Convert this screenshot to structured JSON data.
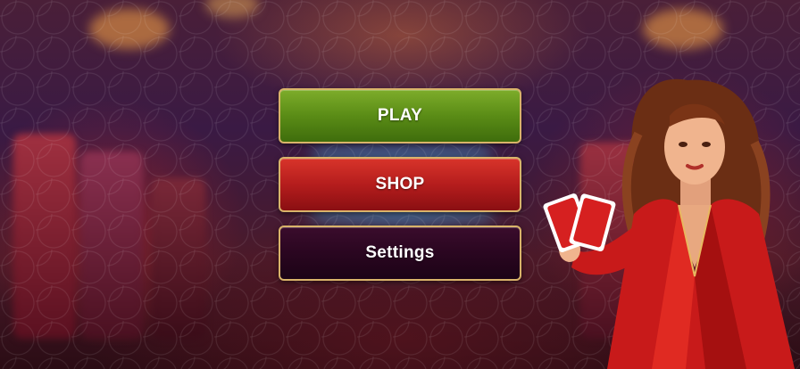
{
  "menu": {
    "play_label": "PLAY",
    "shop_label": "SHOP",
    "settings_label": "Settings"
  },
  "colors": {
    "play": "#5a8c16",
    "shop": "#b51d1d",
    "settings": "#2a0620",
    "button_border": "#d9b36a"
  }
}
